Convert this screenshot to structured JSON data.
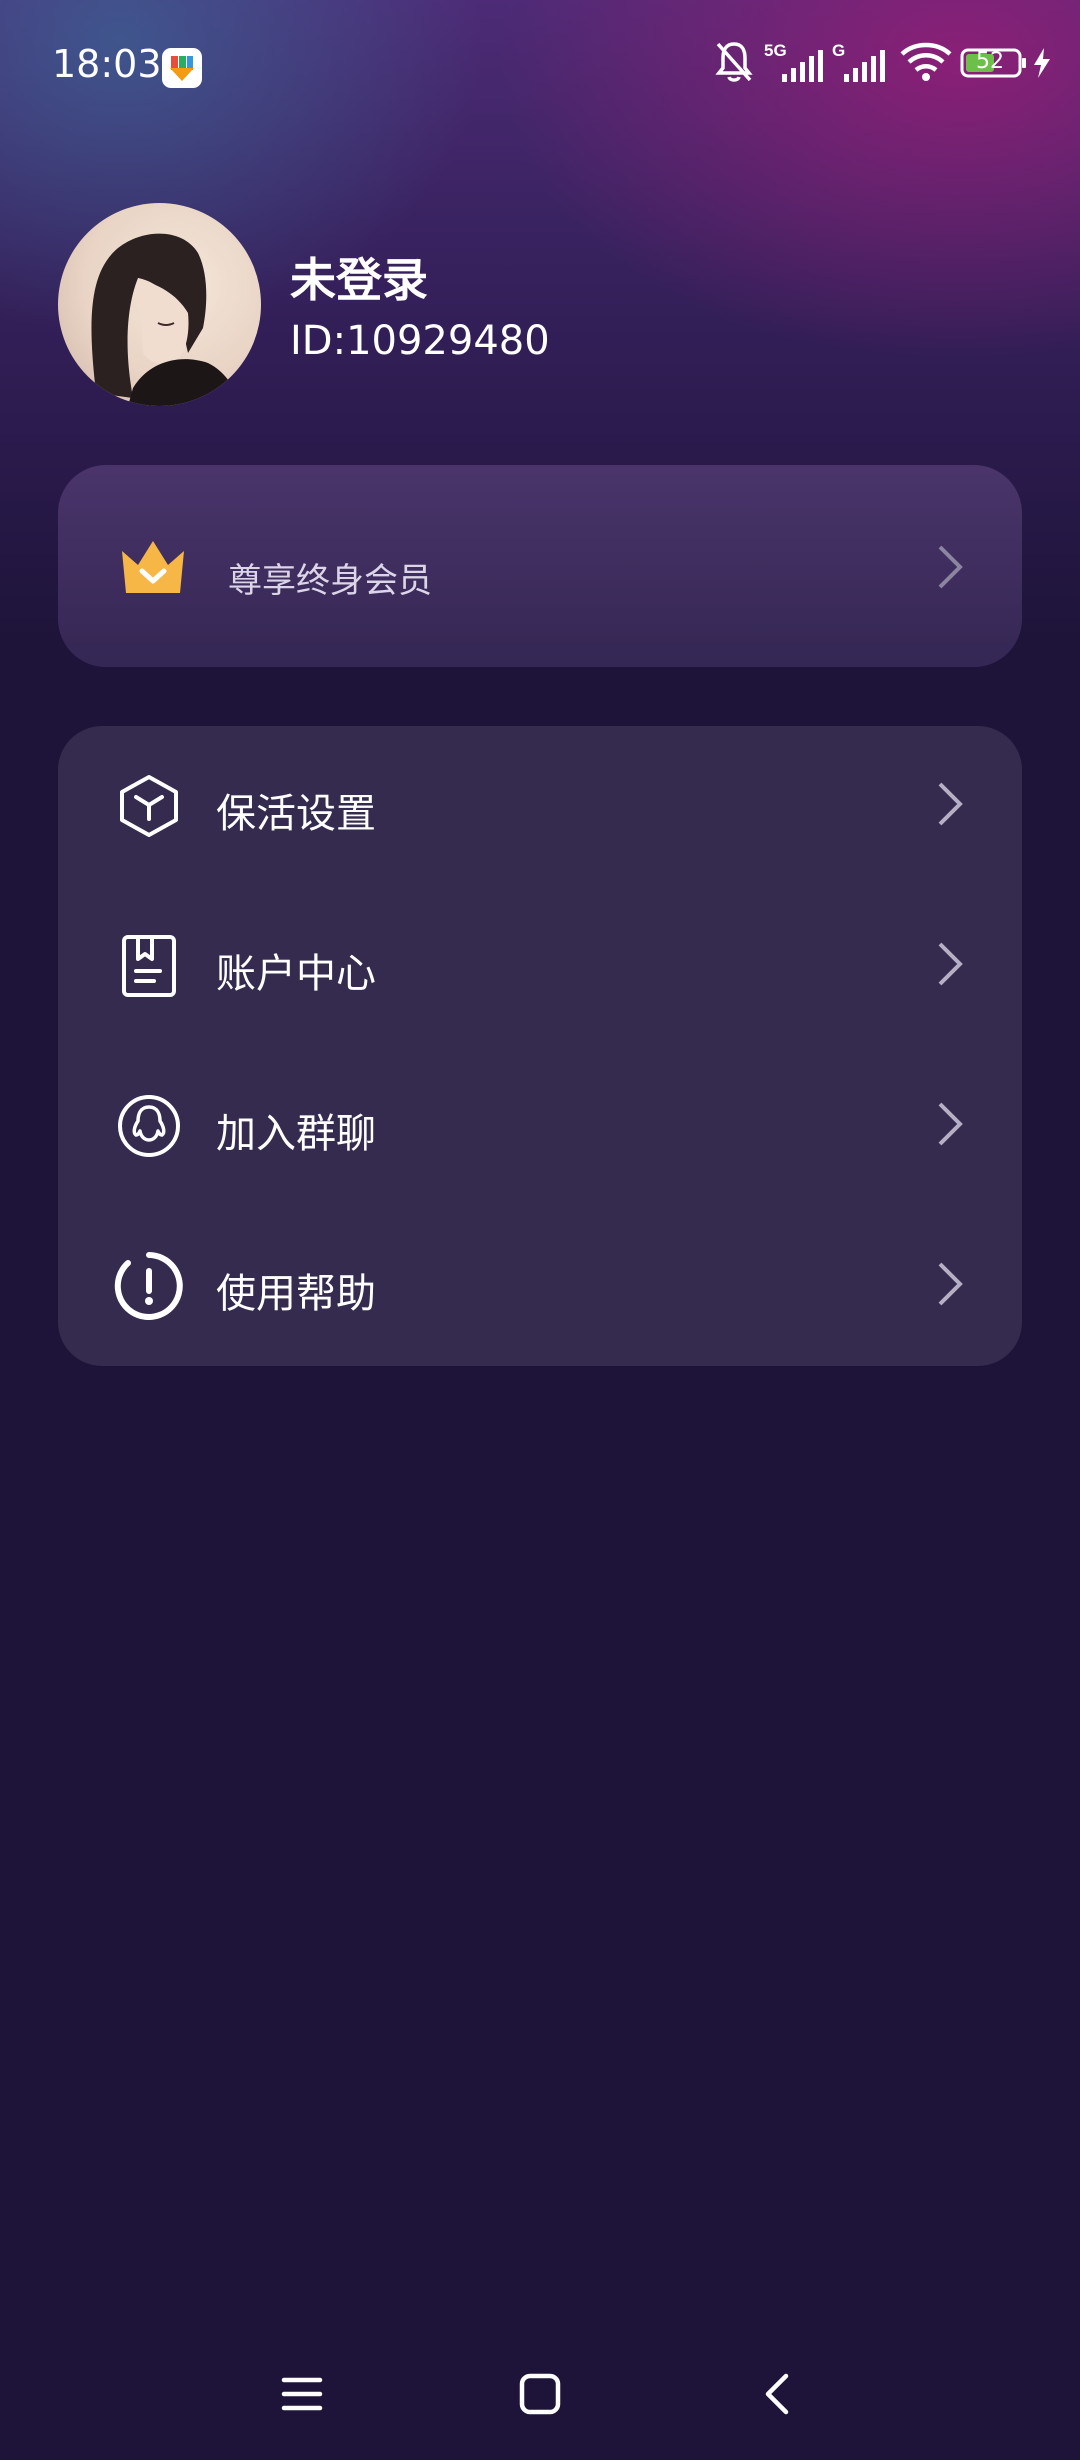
{
  "status_bar": {
    "time": "18:03",
    "battery_level": "52",
    "network_1": "5G",
    "network_2": "G",
    "icons": [
      "app-notification-icon",
      "mute-bell-icon",
      "signal-icon",
      "wifi-icon",
      "battery-icon",
      "charging-icon"
    ]
  },
  "profile": {
    "name": "未登录",
    "id_text": "ID:10929480"
  },
  "vip": {
    "label": "尊享终身会员",
    "icon": "crown-icon"
  },
  "menu": {
    "items": [
      {
        "label": "保活设置",
        "icon": "cube-icon"
      },
      {
        "label": "账户中心",
        "icon": "account-book-icon"
      },
      {
        "label": "加入群聊",
        "icon": "qq-penguin-icon"
      },
      {
        "label": "使用帮助",
        "icon": "help-alert-icon"
      }
    ]
  },
  "colors": {
    "background": "#1e1439",
    "card": "#352b4e",
    "crown": "#f6b746"
  },
  "navigation": [
    "menu-icon",
    "home-icon",
    "back-icon"
  ]
}
